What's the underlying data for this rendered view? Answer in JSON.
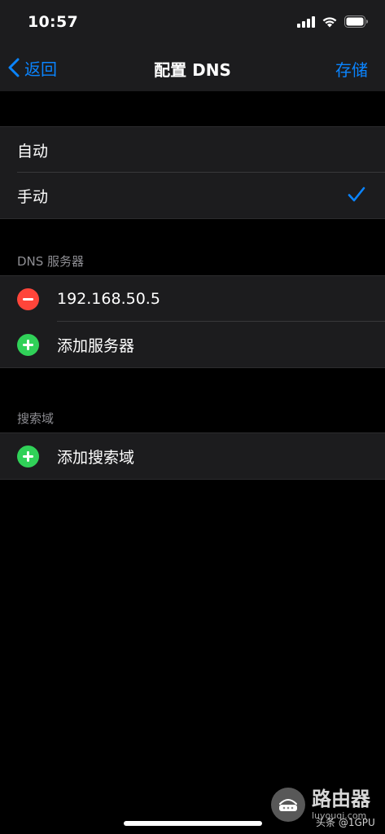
{
  "status_bar": {
    "time": "10:57"
  },
  "nav": {
    "back_label": "返回",
    "title": "配置 DNS",
    "save_label": "存储"
  },
  "mode": {
    "options": [
      {
        "label": "自动",
        "selected": false
      },
      {
        "label": "手动",
        "selected": true
      }
    ]
  },
  "dns_servers": {
    "header": "DNS 服务器",
    "entries": [
      "192.168.50.5"
    ],
    "add_label": "添加服务器"
  },
  "search_domains": {
    "header": "搜索域",
    "add_label": "添加搜索域"
  },
  "watermark": {
    "title": "路由器",
    "url": "luyouqi.com",
    "source": "头条 @1GPU"
  },
  "colors": {
    "accent": "#0a84ff",
    "delete": "#ff453a",
    "add": "#30d158",
    "cell_background": "#1c1c1e",
    "page_background": "#000000",
    "secondary_text": "#8e8e93"
  }
}
